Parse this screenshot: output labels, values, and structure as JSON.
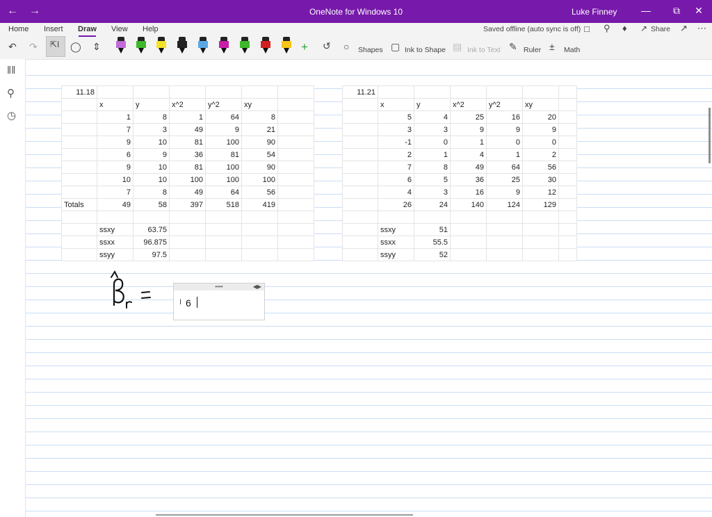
{
  "window": {
    "title": "OneNote for Windows 10",
    "user": "Luke Finney",
    "back_glyph": "←",
    "forward_glyph": "→",
    "minimize_glyph": "—",
    "restore_glyph": "⧉",
    "close_glyph": "✕"
  },
  "ribbon": {
    "tabs": [
      "Home",
      "Insert",
      "Draw",
      "View",
      "Help"
    ],
    "active_tab": "Draw",
    "status": "Saved offline (auto sync is off)",
    "share_label": "Share",
    "buttons": {
      "shapes": "Shapes",
      "ink_to_shape": "Ink to Shape",
      "ink_to_text": "Ink to Text",
      "ruler": "Ruler",
      "math": "Math"
    },
    "pen_colors": [
      "#c06bd6",
      "#3db82b",
      "#f4e22a",
      "#222222",
      "#5aa7e6",
      "#c81ea8",
      "#3db82b",
      "#d11f1f",
      "#f6c51b"
    ],
    "accent": "#7719aa"
  },
  "table_left": {
    "label": "11.18",
    "headers": [
      "x",
      "y",
      "x^2",
      "y^2",
      "xy"
    ],
    "rows": [
      [
        "1",
        "8",
        "1",
        "64",
        "8"
      ],
      [
        "7",
        "3",
        "49",
        "9",
        "21"
      ],
      [
        "9",
        "10",
        "81",
        "100",
        "90"
      ],
      [
        "6",
        "9",
        "36",
        "81",
        "54"
      ],
      [
        "9",
        "10",
        "81",
        "100",
        "90"
      ],
      [
        "10",
        "10",
        "100",
        "100",
        "100"
      ],
      [
        "7",
        "8",
        "49",
        "64",
        "56"
      ]
    ],
    "totals_label": "Totals",
    "totals": [
      "49",
      "58",
      "397",
      "518",
      "419"
    ],
    "stats": [
      {
        "label": "ssxy",
        "value": "63.75"
      },
      {
        "label": "ssxx",
        "value": "96.875"
      },
      {
        "label": "ssyy",
        "value": "97.5"
      }
    ]
  },
  "table_right": {
    "label": "11.21",
    "headers": [
      "x",
      "y",
      "x^2",
      "y^2",
      "xy"
    ],
    "rows": [
      [
        "5",
        "4",
        "25",
        "16",
        "20"
      ],
      [
        "3",
        "3",
        "9",
        "9",
        "9"
      ],
      [
        "-1",
        "0",
        "1",
        "0",
        "0"
      ],
      [
        "2",
        "1",
        "4",
        "1",
        "2"
      ],
      [
        "7",
        "8",
        "49",
        "64",
        "56"
      ],
      [
        "6",
        "5",
        "36",
        "25",
        "30"
      ],
      [
        "4",
        "3",
        "16",
        "9",
        "12"
      ]
    ],
    "totals": [
      "26",
      "24",
      "140",
      "124",
      "129"
    ],
    "stats": [
      {
        "label": "ssxy",
        "value": "51"
      },
      {
        "label": "ssxx",
        "value": "55.5"
      },
      {
        "label": "ssyy",
        "value": "52"
      }
    ]
  },
  "ink": {
    "symbol": "β̂",
    "subscript": "r",
    "equals": "="
  },
  "math_input": {
    "value": "6"
  }
}
